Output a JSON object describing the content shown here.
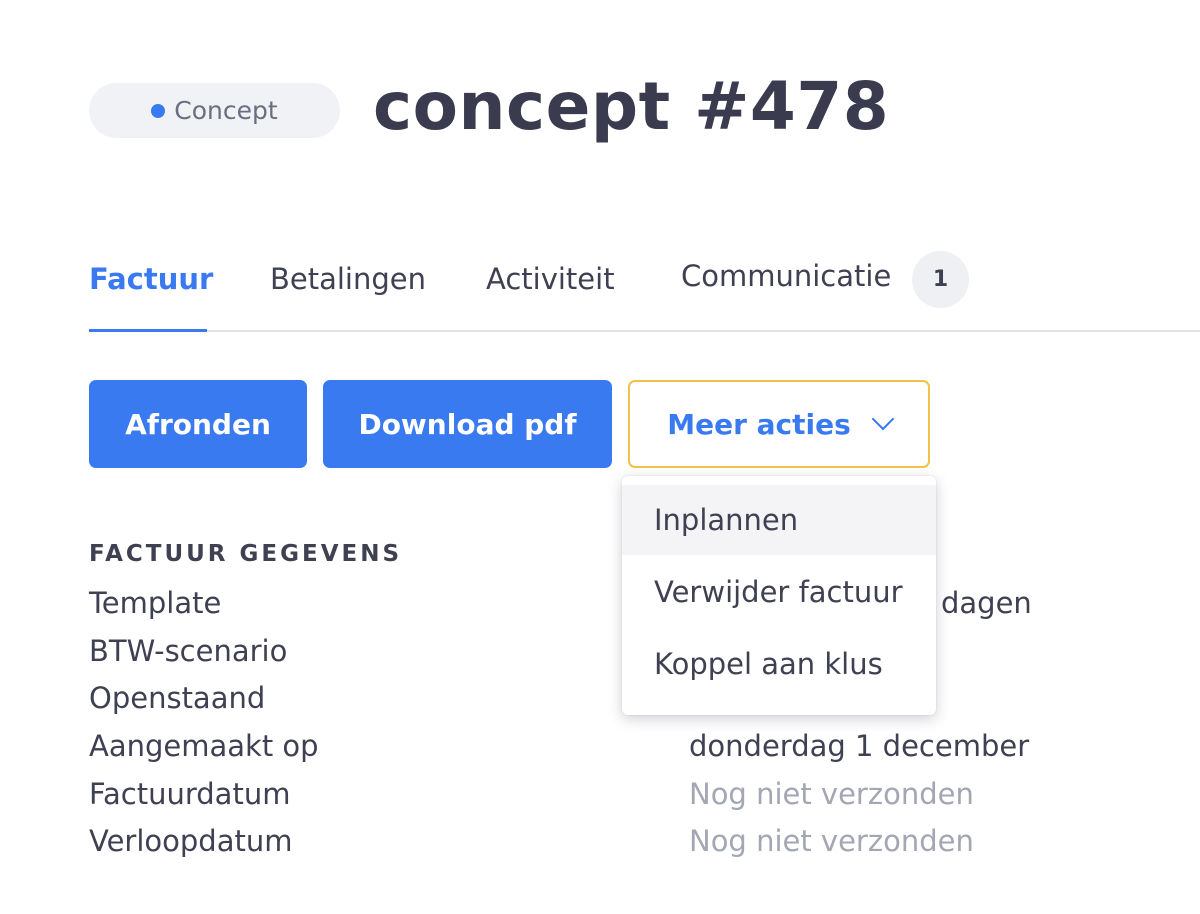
{
  "header": {
    "status": "Concept",
    "title": "concept #478"
  },
  "tabs": [
    {
      "label": "Factuur",
      "active": true
    },
    {
      "label": "Betalingen",
      "active": false
    },
    {
      "label": "Activiteit",
      "active": false
    },
    {
      "label": "Communicatie",
      "active": false,
      "badge": "1"
    }
  ],
  "actions": {
    "finish": "Afronden",
    "download": "Download pdf",
    "more": "Meer acties"
  },
  "dropdown": {
    "items": [
      "Inplannen",
      "Verwijder factuur",
      "Koppel aan klus"
    ]
  },
  "details": {
    "title": "FACTUUR GEGEVENS",
    "rows": [
      {
        "label": "Template",
        "value": "dagen"
      },
      {
        "label": "BTW-scenario",
        "value": ""
      },
      {
        "label": "Openstaand",
        "value": ""
      },
      {
        "label": "Aangemaakt op",
        "value": "donderdag 1 december"
      },
      {
        "label": "Factuurdatum",
        "value": "Nog niet verzonden"
      },
      {
        "label": "Verloopdatum",
        "value": "Nog niet verzonden"
      }
    ]
  },
  "colors": {
    "accent": "#3a7af0",
    "focus_border": "#f3c04a",
    "text": "#3f4052",
    "muted": "#a3a6b3"
  }
}
